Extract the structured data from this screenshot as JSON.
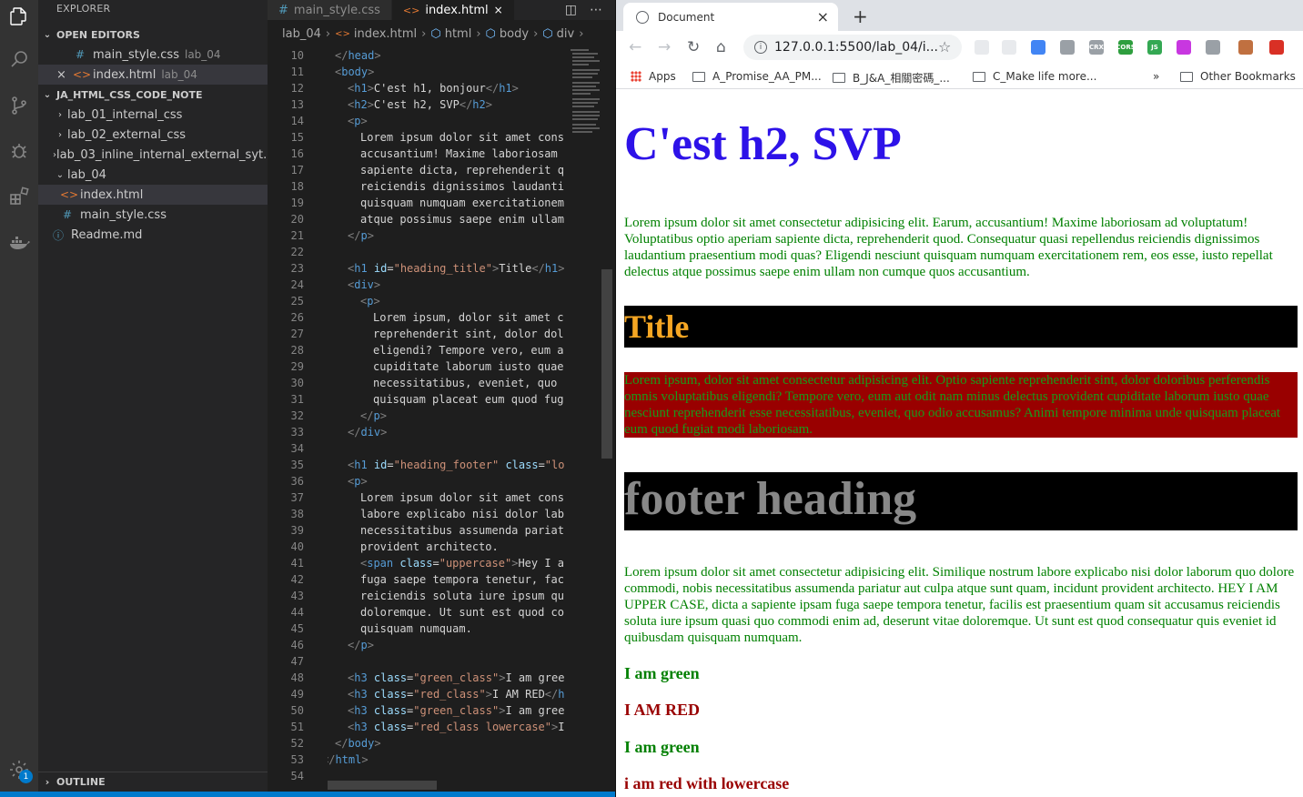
{
  "vscode": {
    "explorer_title": "EXPLORER",
    "open_editors_label": "OPEN EDITORS",
    "open_editors": [
      {
        "name": "main_style.css",
        "desc": "lab_04",
        "icon": "css-file-icon"
      },
      {
        "name": "index.html",
        "desc": "lab_04",
        "icon": "html-file-icon"
      }
    ],
    "workspace_label": "JA_HTML_CSS_CODE_NOTE",
    "tree": [
      {
        "label": "lab_01_internal_css"
      },
      {
        "label": "lab_02_external_css"
      },
      {
        "label": "lab_03_inline_internal_external_syt..."
      },
      {
        "label": "lab_04"
      },
      {
        "label": "index.html"
      },
      {
        "label": "main_style.css"
      },
      {
        "label": "Readme.md"
      }
    ],
    "outline_label": "OUTLINE",
    "badge_count": "1",
    "tabs": [
      {
        "label": "main_style.css"
      },
      {
        "label": "index.html"
      }
    ],
    "breadcrumb": [
      "lab_04",
      "index.html",
      "html",
      "body",
      "div"
    ],
    "line_numbers": [
      "10",
      "11",
      "12",
      "13",
      "14",
      "15",
      "16",
      "17",
      "18",
      "19",
      "20",
      "21",
      "22",
      "23",
      "24",
      "25",
      "26",
      "27",
      "28",
      "29",
      "30",
      "31",
      "32",
      "33",
      "34",
      "35",
      "36",
      "37",
      "38",
      "39",
      "40",
      "41",
      "42",
      "43",
      "44",
      "45",
      "46",
      "47",
      "48",
      "49",
      "50",
      "51",
      "52",
      "53",
      "54"
    ],
    "code_lines": [
      "</head>",
      "<body>",
      "<h1>C'est h1, bonjour</h1>",
      "<h2>C'est h2, SVP</h2>",
      "<p>",
      "Lorem ipsum dolor sit amet cons",
      "accusantium! Maxime laboriosam",
      "sapiente dicta, reprehenderit q",
      "reiciendis dignissimos laudanti",
      "quisquam numquam exercitationem",
      "atque possimus saepe enim ullam",
      "</p>",
      "",
      "<h1 id=\"heading_title\">Title</h1>",
      "<div>",
      "<p>",
      "Lorem ipsum, dolor sit amet c",
      "reprehenderit sint, dolor dol",
      "eligendi? Tempore vero, eum a",
      "cupiditate laborum iusto quae",
      "necessitatibus, eveniet, quo ",
      "quisquam placeat eum quod fug",
      "</p>",
      "</div>",
      "",
      "<h1 id=\"heading_footer\" class=\"lo",
      "<p>",
      "Lorem ipsum dolor sit amet cons",
      "labore explicabo nisi dolor lab",
      "necessitatibus assumenda pariat",
      "provident architecto.",
      "<span class=\"uppercase\">Hey I a",
      "fuga saepe tempora tenetur, fac",
      "reiciendis soluta iure ipsum qu",
      "doloremque. Ut sunt est quod co",
      "quisquam numquam.",
      "</p>",
      "",
      "<h3 class=\"green_class\">I am gree",
      "<h3 class=\"red_class\">I AM RED</h",
      "<h3 class=\"green_class\">I am gree",
      "<h3 class=\"red_class lowercase\">I",
      "</body>",
      "</html>",
      ""
    ]
  },
  "browser": {
    "tab_title": "Document",
    "url": "127.0.0.1:5500/lab_04/i...",
    "bookmarks": [
      {
        "label": "Apps"
      },
      {
        "label": "A_Promise_AA_PM..."
      },
      {
        "label": "B_J&A_相關密碼_..."
      },
      {
        "label": "C_Make life more..."
      },
      {
        "label": "Other Bookmarks"
      }
    ],
    "overflow": "»",
    "extensions": [
      {
        "label": "",
        "color": "#e8eaed"
      },
      {
        "label": "",
        "color": "#e8eaed"
      },
      {
        "label": "",
        "color": "#4285f4"
      },
      {
        "label": "",
        "color": "#9aa0a6"
      },
      {
        "label": "CRX",
        "color": "#9aa0a6"
      },
      {
        "label": "CORS",
        "color": "#2e9e3e"
      },
      {
        "label": "JS",
        "color": "#34a853"
      },
      {
        "label": "",
        "color": "#c837e0"
      },
      {
        "label": "",
        "color": "#9aa0a6"
      },
      {
        "label": "",
        "color": "#c07040"
      },
      {
        "label": "",
        "color": "#d93025"
      }
    ],
    "page": {
      "h2": "C'est h2, SVP",
      "p1": "Lorem ipsum dolor sit amet consectetur adipisicing elit. Earum, accusantium! Maxime laboriosam ad voluptatum! Voluptatibus optio aperiam sapiente dicta, reprehenderit quod. Consequatur quasi repellendus reiciendis dignissimos laudantium praesentium modi quas? Eligendi nesciunt quisquam numquam exercitationem rem, eos esse, iusto repellat delectus atque possimus saepe enim ullam non cumque quos accusantium.",
      "title": "Title",
      "red_para": "Lorem ipsum, dolor sit amet consectetur adipisicing elit. Optio sapiente reprehenderit sint, dolor doloribus perferendis omnis voluptatibus eligendi? Tempore vero, eum aut odit nam minus delectus provident cupiditate laborum iusto quae nesciunt reprehenderit esse necessitatibus, eveniet, quo odio accusamus? Animi tempore minima unde quisquam placeat eum quod fugiat modi laboriosam.",
      "footer_heading": "footer heading",
      "p2": "Lorem ipsum dolor sit amet consectetur adipisicing elit. Similique nostrum labore explicabo nisi dolor laborum quo dolore commodi, nobis necessitatibus assumenda pariatur aut culpa atque sunt quam, incidunt provident architecto. HEY I AM UPPER CASE, dicta a sapiente ipsam fuga saepe tempora tenetur, facilis est praesentium quam sit accusamus reiciendis soluta iure ipsum quasi quo commodi enim ad, deserunt vitae doloremque. Ut sunt est quod consequatur quis eveniet id quibusdam quisquam numquam.",
      "h3": [
        "I am green",
        "I AM RED",
        "I am green",
        "i am red with lowercase"
      ]
    }
  }
}
